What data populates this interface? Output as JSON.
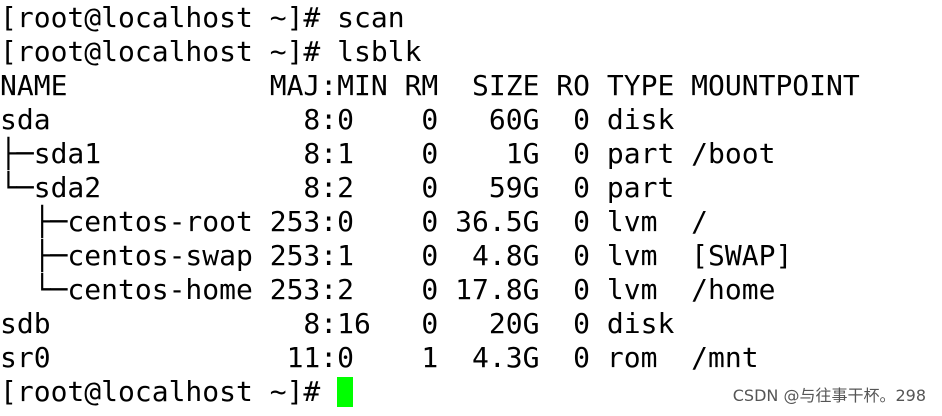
{
  "terminal": {
    "prompt": "[root@localhost ~]# ",
    "commands": [
      "scan",
      "lsblk"
    ],
    "lsblk": {
      "header": "NAME            MAJ:MIN RM  SIZE RO TYPE MOUNTPOINT",
      "rows": [
        "sda               8:0    0   60G  0 disk ",
        "├─sda1            8:1    0    1G  0 part /boot",
        "└─sda2            8:2    0   59G  0 part ",
        "  ├─centos-root 253:0    0 36.5G  0 lvm  /",
        "  ├─centos-swap 253:1    0  4.8G  0 lvm  [SWAP]",
        "  └─centos-home 253:2    0 17.8G  0 lvm  /home",
        "sdb               8:16   0   20G  0 disk ",
        "sr0              11:0    1  4.3G  0 rom  /mnt"
      ]
    },
    "cursor_color": "#00ff00"
  },
  "watermark": "CSDN @与往事干杯。298"
}
